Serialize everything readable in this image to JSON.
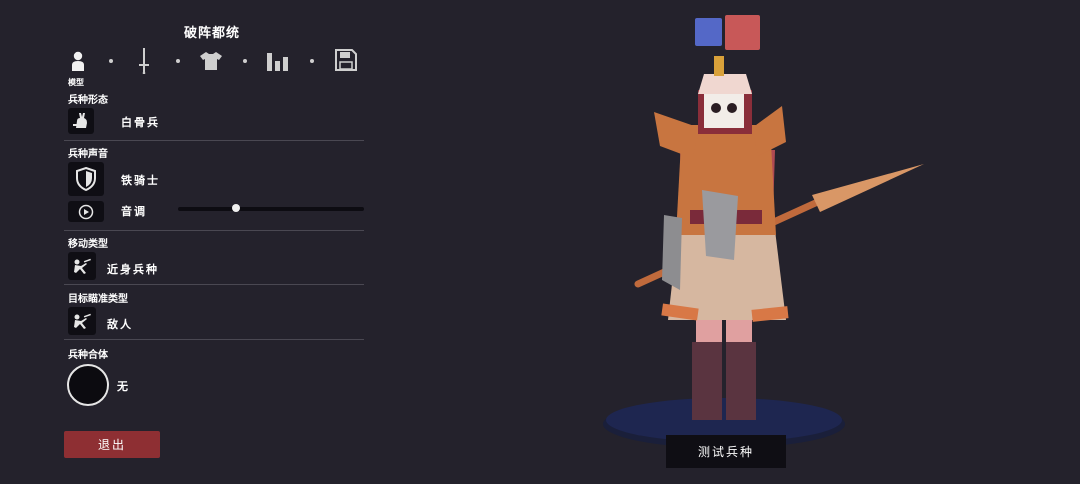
{
  "header": {
    "title": "破阵都统"
  },
  "steps": {
    "active_label": "模型",
    "items": [
      {
        "icon": "person-icon"
      },
      {
        "icon": "sword-icon"
      },
      {
        "icon": "shirt-icon"
      },
      {
        "icon": "bar-chart-icon"
      },
      {
        "icon": "save-icon"
      }
    ]
  },
  "sections": {
    "appearance": {
      "label": "兵种形态",
      "value": "白骨兵",
      "icon": "rabbit-icon"
    },
    "voice": {
      "label": "兵种声音",
      "value": "铁骑士",
      "icon": "shield-icon",
      "pitch_label": "音调",
      "pitch_level": 0.31,
      "play_icon": "play-icon"
    },
    "movement": {
      "label": "移动类型",
      "value": "近身兵种",
      "icon": "charging-unit-icon"
    },
    "targeting": {
      "label": "目标瞄准类型",
      "value": "敌人",
      "icon": "charging-unit-icon"
    },
    "merge": {
      "label": "兵种合体",
      "value": "无",
      "icon": "empty-circle"
    }
  },
  "buttons": {
    "exit_label": "退出",
    "test_label": "测试兵种"
  },
  "team_colors": {
    "blue": "#5468c7",
    "red": "#c85858"
  },
  "colors": {
    "background": "#24222c",
    "exit": "#8e2f33",
    "panel": "#0f0e14"
  }
}
